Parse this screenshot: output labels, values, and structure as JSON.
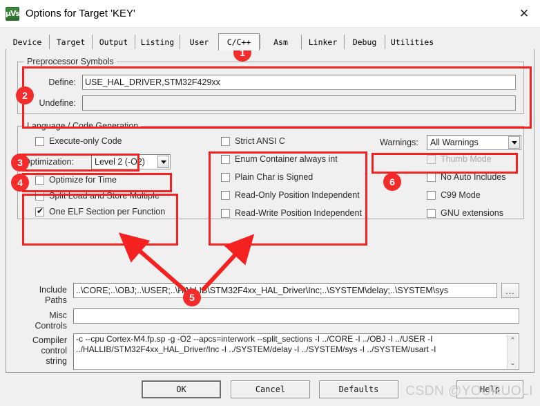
{
  "window": {
    "title": "Options for Target 'KEY'",
    "app_icon": "uvision-icon",
    "close_label": "✕"
  },
  "tabs": [
    {
      "label": "Device",
      "active": false
    },
    {
      "label": "Target",
      "active": false
    },
    {
      "label": "Output",
      "active": false
    },
    {
      "label": "Listing",
      "active": false
    },
    {
      "label": "User",
      "active": false
    },
    {
      "label": "C/C++",
      "active": true
    },
    {
      "label": "Asm",
      "active": false
    },
    {
      "label": "Linker",
      "active": false
    },
    {
      "label": "Debug",
      "active": false
    },
    {
      "label": "Utilities",
      "active": false
    }
  ],
  "preprocessor": {
    "legend": "Preprocessor Symbols",
    "define_label": "Define:",
    "define_value": "USE_HAL_DRIVER,STM32F429xx",
    "undefine_label": "Undefine:",
    "undefine_value": ""
  },
  "language": {
    "legend": "Language / Code Generation",
    "execute_only": {
      "label": "Execute-only Code",
      "checked": false,
      "disabled": false
    },
    "optimization_label": "Optimization:",
    "optimization_value": "Level 2 (-O2)",
    "optimize_for_time": {
      "label": "Optimize for Time",
      "checked": false,
      "disabled": false
    },
    "split_load_store": {
      "label": "Split Load and Store Multiple",
      "checked": false,
      "disabled": false
    },
    "one_elf_section": {
      "label": "One ELF Section per Function",
      "checked": true,
      "disabled": false
    },
    "strict_ansi_c": {
      "label": "Strict ANSI C",
      "checked": false,
      "disabled": false
    },
    "enum_container": {
      "label": "Enum Container always int",
      "checked": false,
      "disabled": false
    },
    "plain_char_signed": {
      "label": "Plain Char is Signed",
      "checked": false,
      "disabled": false
    },
    "ro_position_independent": {
      "label": "Read-Only Position Independent",
      "checked": false,
      "disabled": false
    },
    "rw_position_independent": {
      "label": "Read-Write Position Independent",
      "checked": false,
      "disabled": false
    },
    "warnings_label": "Warnings:",
    "warnings_value": "All Warnings",
    "thumb_mode": {
      "label": "Thumb Mode",
      "checked": false,
      "disabled": true
    },
    "no_auto_includes": {
      "label": "No Auto Includes",
      "checked": false,
      "disabled": false
    },
    "c99_mode": {
      "label": "C99 Mode",
      "checked": false,
      "disabled": false
    },
    "gnu_extensions": {
      "label": "GNU extensions",
      "checked": false,
      "disabled": false
    }
  },
  "paths": {
    "include_label_line1": "Include",
    "include_label_line2": "Paths",
    "include_value": "..\\CORE;..\\OBJ;..\\USER;..\\HALLIB\\STM32F4xx_HAL_Driver\\Inc;..\\SYSTEM\\delay;..\\SYSTEM\\sys",
    "browse_label": "...",
    "misc_label_line1": "Misc",
    "misc_label_line2": "Controls",
    "misc_value": "",
    "compiler_label_line1": "Compiler",
    "compiler_label_line2": "control",
    "compiler_label_line3": "string",
    "compiler_line1": "-c --cpu Cortex-M4.fp.sp -g -O2 --apcs=interwork --split_sections -I ../CORE -I ../OBJ -I ../USER -I",
    "compiler_line2": "../HALLIB/STM32F4xx_HAL_Driver/Inc -I ../SYSTEM/delay -I ../SYSTEM/sys -I ../SYSTEM/usart -I",
    "scroll_up": "⌃",
    "scroll_down": "⌄"
  },
  "buttons": {
    "ok": "OK",
    "cancel": "Cancel",
    "defaults": "Defaults",
    "help": "Help"
  },
  "annotations": {
    "badge1": "1",
    "badge2": "2",
    "badge3": "3",
    "badge4": "4",
    "badge5": "5",
    "badge6": "6",
    "highlight_color": "#f52020"
  },
  "watermark": "CSDN @YOURUOLI"
}
